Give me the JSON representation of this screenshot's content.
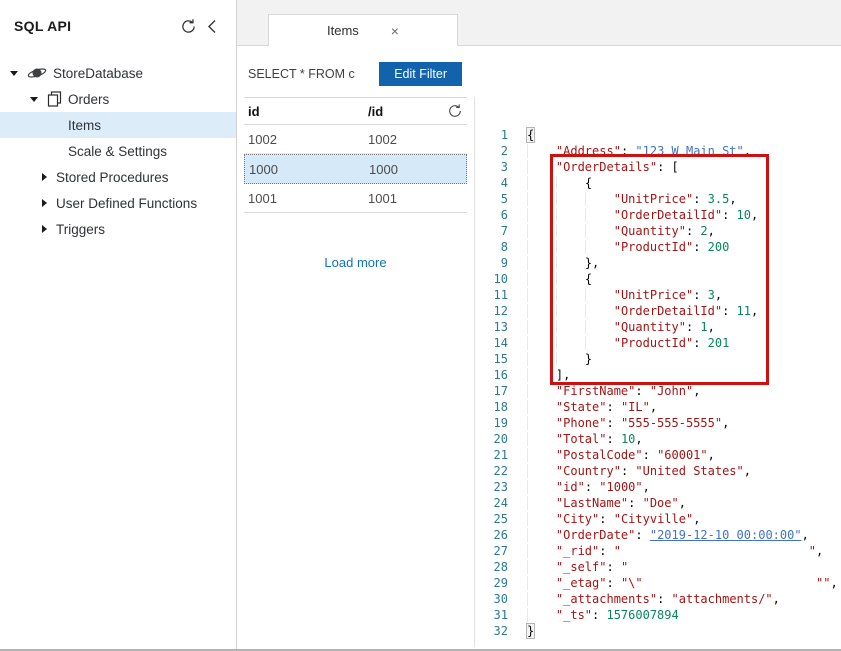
{
  "sidebar": {
    "title": "SQL API",
    "tree": {
      "database": "StoreDatabase",
      "collection": "Orders",
      "items": [
        {
          "label": "Items",
          "selected": true
        },
        {
          "label": "Scale & Settings",
          "selected": false
        },
        {
          "label": "Stored Procedures",
          "collapsed": true
        },
        {
          "label": "User Defined Functions",
          "collapsed": true
        },
        {
          "label": "Triggers",
          "collapsed": true
        }
      ]
    }
  },
  "tab": {
    "label": "Items",
    "close_glyph": "×"
  },
  "query": {
    "text": "SELECT * FROM c",
    "edit_filter_label": "Edit Filter"
  },
  "documents": {
    "columns": [
      "id",
      "/id"
    ],
    "rows": [
      [
        "1002",
        "1002"
      ],
      [
        "1000",
        "1000"
      ],
      [
        "1001",
        "1001"
      ]
    ],
    "selected_row_index": 1,
    "load_more_label": "Load more"
  },
  "editor": {
    "highlighted_lines": "3-16",
    "lines": [
      {
        "n": 1,
        "indent": 0,
        "bm": true,
        "segs": [
          [
            "p",
            "{"
          ]
        ]
      },
      {
        "n": 2,
        "indent": 1,
        "segs": [
          [
            "k",
            "\"Address\""
          ],
          [
            "p",
            ": "
          ],
          [
            "l",
            "\"123 W Main St\""
          ],
          [
            "p",
            ","
          ]
        ]
      },
      {
        "n": 3,
        "indent": 1,
        "segs": [
          [
            "k",
            "\"OrderDetails\""
          ],
          [
            "p",
            ": ["
          ]
        ]
      },
      {
        "n": 4,
        "indent": 2,
        "segs": [
          [
            "p",
            "{"
          ]
        ]
      },
      {
        "n": 5,
        "indent": 3,
        "segs": [
          [
            "k",
            "\"UnitPrice\""
          ],
          [
            "p",
            ": "
          ],
          [
            "n",
            "3.5"
          ],
          [
            "p",
            ","
          ]
        ]
      },
      {
        "n": 6,
        "indent": 3,
        "segs": [
          [
            "k",
            "\"OrderDetailId\""
          ],
          [
            "p",
            ": "
          ],
          [
            "n",
            "10"
          ],
          [
            "p",
            ","
          ]
        ]
      },
      {
        "n": 7,
        "indent": 3,
        "segs": [
          [
            "k",
            "\"Quantity\""
          ],
          [
            "p",
            ": "
          ],
          [
            "n",
            "2"
          ],
          [
            "p",
            ","
          ]
        ]
      },
      {
        "n": 8,
        "indent": 3,
        "segs": [
          [
            "k",
            "\"ProductId\""
          ],
          [
            "p",
            ": "
          ],
          [
            "n",
            "200"
          ]
        ]
      },
      {
        "n": 9,
        "indent": 2,
        "segs": [
          [
            "p",
            "},"
          ]
        ]
      },
      {
        "n": 10,
        "indent": 2,
        "segs": [
          [
            "p",
            "{"
          ]
        ]
      },
      {
        "n": 11,
        "indent": 3,
        "segs": [
          [
            "k",
            "\"UnitPrice\""
          ],
          [
            "p",
            ": "
          ],
          [
            "n",
            "3"
          ],
          [
            "p",
            ","
          ]
        ]
      },
      {
        "n": 12,
        "indent": 3,
        "segs": [
          [
            "k",
            "\"OrderDetailId\""
          ],
          [
            "p",
            ": "
          ],
          [
            "n",
            "11"
          ],
          [
            "p",
            ","
          ]
        ]
      },
      {
        "n": 13,
        "indent": 3,
        "segs": [
          [
            "k",
            "\"Quantity\""
          ],
          [
            "p",
            ": "
          ],
          [
            "n",
            "1"
          ],
          [
            "p",
            ","
          ]
        ]
      },
      {
        "n": 14,
        "indent": 3,
        "segs": [
          [
            "k",
            "\"ProductId\""
          ],
          [
            "p",
            ": "
          ],
          [
            "n",
            "201"
          ]
        ]
      },
      {
        "n": 15,
        "indent": 2,
        "segs": [
          [
            "p",
            "}"
          ]
        ]
      },
      {
        "n": 16,
        "indent": 1,
        "segs": [
          [
            "p",
            "],"
          ]
        ]
      },
      {
        "n": 17,
        "indent": 1,
        "segs": [
          [
            "k",
            "\"FirstName\""
          ],
          [
            "p",
            ": "
          ],
          [
            "s",
            "\"John\""
          ],
          [
            "p",
            ","
          ]
        ]
      },
      {
        "n": 18,
        "indent": 1,
        "segs": [
          [
            "k",
            "\"State\""
          ],
          [
            "p",
            ": "
          ],
          [
            "s",
            "\"IL\""
          ],
          [
            "p",
            ","
          ]
        ]
      },
      {
        "n": 19,
        "indent": 1,
        "segs": [
          [
            "k",
            "\"Phone\""
          ],
          [
            "p",
            ": "
          ],
          [
            "s",
            "\"555-555-5555\""
          ],
          [
            "p",
            ","
          ]
        ]
      },
      {
        "n": 20,
        "indent": 1,
        "segs": [
          [
            "k",
            "\"Total\""
          ],
          [
            "p",
            ": "
          ],
          [
            "n",
            "10"
          ],
          [
            "p",
            ","
          ]
        ]
      },
      {
        "n": 21,
        "indent": 1,
        "segs": [
          [
            "k",
            "\"PostalCode\""
          ],
          [
            "p",
            ": "
          ],
          [
            "s",
            "\"60001\""
          ],
          [
            "p",
            ","
          ]
        ]
      },
      {
        "n": 22,
        "indent": 1,
        "segs": [
          [
            "k",
            "\"Country\""
          ],
          [
            "p",
            ": "
          ],
          [
            "s",
            "\"United States\""
          ],
          [
            "p",
            ","
          ]
        ]
      },
      {
        "n": 23,
        "indent": 1,
        "segs": [
          [
            "k",
            "\"id\""
          ],
          [
            "p",
            ": "
          ],
          [
            "s",
            "\"1000\""
          ],
          [
            "p",
            ","
          ]
        ]
      },
      {
        "n": 24,
        "indent": 1,
        "segs": [
          [
            "k",
            "\"LastName\""
          ],
          [
            "p",
            ": "
          ],
          [
            "s",
            "\"Doe\""
          ],
          [
            "p",
            ","
          ]
        ]
      },
      {
        "n": 25,
        "indent": 1,
        "segs": [
          [
            "k",
            "\"City\""
          ],
          [
            "p",
            ": "
          ],
          [
            "s",
            "\"Cityville\""
          ],
          [
            "p",
            ","
          ]
        ]
      },
      {
        "n": 26,
        "indent": 1,
        "segs": [
          [
            "k",
            "\"OrderDate\""
          ],
          [
            "p",
            ": "
          ],
          [
            "l",
            "\"2019-12-10 00:00:00\""
          ],
          [
            "p",
            ","
          ]
        ]
      },
      {
        "n": 27,
        "indent": 1,
        "segs": [
          [
            "k",
            "\"_rid\""
          ],
          [
            "p",
            ": "
          ],
          [
            "s",
            "\""
          ],
          [
            "w",
            "                          "
          ],
          [
            "s",
            "\""
          ],
          [
            "p",
            ","
          ]
        ]
      },
      {
        "n": 28,
        "indent": 1,
        "segs": [
          [
            "k",
            "\"_self\""
          ],
          [
            "p",
            ": "
          ],
          [
            "s",
            "\""
          ]
        ]
      },
      {
        "n": 29,
        "indent": 1,
        "segs": [
          [
            "k",
            "\"_etag\""
          ],
          [
            "p",
            ": "
          ],
          [
            "s",
            "\"\\\""
          ],
          [
            "w",
            "                        "
          ],
          [
            "s",
            "\"\""
          ],
          [
            "p",
            ","
          ]
        ]
      },
      {
        "n": 30,
        "indent": 1,
        "segs": [
          [
            "k",
            "\"_attachments\""
          ],
          [
            "p",
            ": "
          ],
          [
            "s",
            "\"attachments/\""
          ],
          [
            "p",
            ","
          ]
        ]
      },
      {
        "n": 31,
        "indent": 1,
        "segs": [
          [
            "k",
            "\"_ts\""
          ],
          [
            "p",
            ": "
          ],
          [
            "n",
            "1576007894"
          ]
        ]
      },
      {
        "n": 32,
        "indent": 0,
        "bm": true,
        "segs": [
          [
            "p",
            "}"
          ]
        ]
      }
    ]
  },
  "colors": {
    "primary_button": "#1263ac",
    "link": "#1371b9",
    "tree_selection": "#dcecf9",
    "row_selection": "#d6e9f8",
    "line_number": "#2b7a93",
    "json_key": "#a31515",
    "json_string": "#a31515",
    "json_number": "#098658",
    "json_linked_value": "#4272c4",
    "annotation_red": "#cc1111"
  },
  "icons": {
    "refresh": "circular-arrow",
    "collapse_panel": "chevron-left",
    "database": "planet",
    "collection": "pages",
    "tab_close": "x"
  }
}
